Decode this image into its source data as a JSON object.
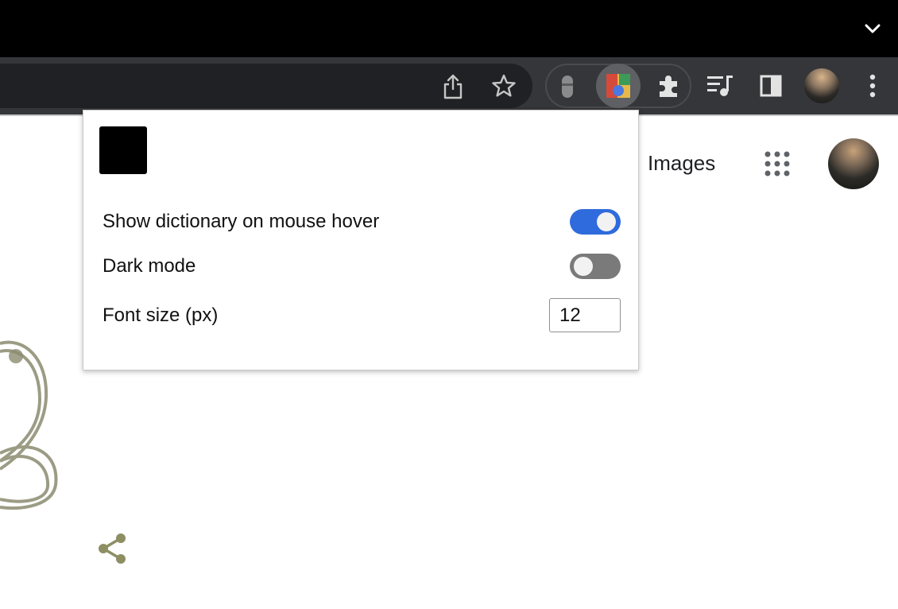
{
  "popup": {
    "settings": [
      {
        "label": "Show dictionary on mouse hover",
        "enabled": true
      },
      {
        "label": "Dark mode",
        "enabled": false
      }
    ],
    "font_size": {
      "label": "Font size (px)",
      "value": "12"
    }
  },
  "page": {
    "images_link": "Images"
  },
  "colors": {
    "toggle_on": "#2f6bdc",
    "toggle_off": "#7a7a7a",
    "titlebar": "#000000",
    "toolbar": "#35363a"
  },
  "icons": [
    "chevron-down-icon",
    "share-icon",
    "star-icon",
    "extension-icon",
    "puzzle-icon",
    "reading-list-icon",
    "side-panel-icon",
    "profile-avatar",
    "more-vert-icon",
    "apps-grid-icon"
  ]
}
